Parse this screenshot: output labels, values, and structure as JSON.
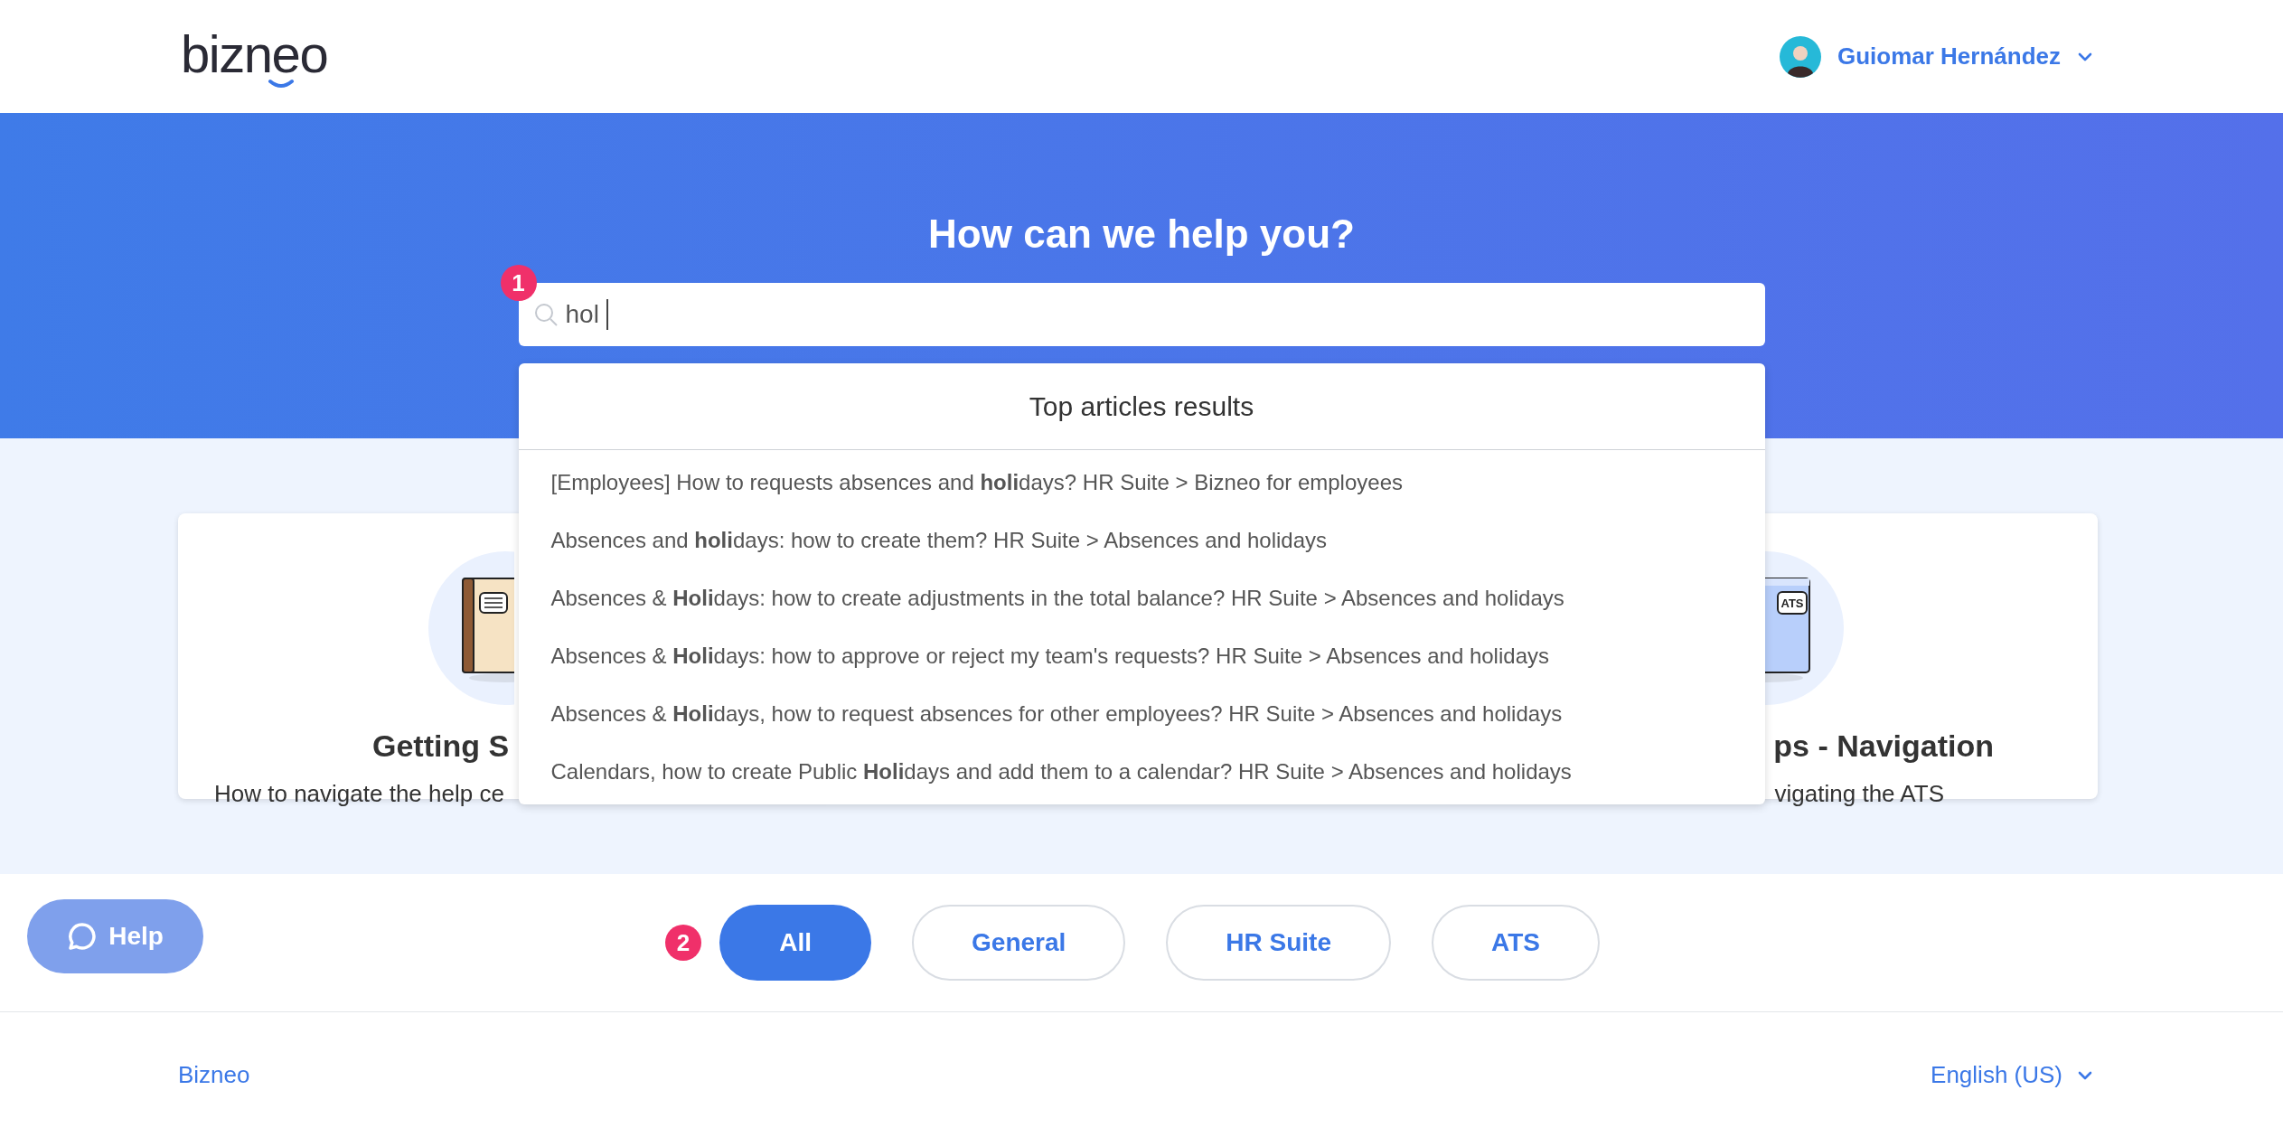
{
  "header": {
    "logo": "bizneo",
    "user": {
      "name": "Guiomar Hernández"
    }
  },
  "hero": {
    "title": "How can we help you?",
    "step_badge": "1",
    "search": {
      "value": "hol"
    }
  },
  "dropdown": {
    "title": "Top articles results",
    "results": [
      {
        "text": "[Employees] How to requests absences and **holi**days? HR Suite > Bizneo for employees"
      },
      {
        "text": "Absences and **holi**days: how to create them? HR Suite > Absences and holidays"
      },
      {
        "text": "Absences & **Holi**days: how to create adjustments in the total balance? HR Suite > Absences and holidays"
      },
      {
        "text": "Absences & **Holi**days: how to approve or reject my team's requests? HR Suite > Absences and holidays"
      },
      {
        "text": "Absences & **Holi**days, how to request absences for other employees? HR Suite > Absences and holidays"
      },
      {
        "text": "Calendars, how to create Public **Holi**days and add them to a calendar? HR Suite > Absences and holidays"
      }
    ]
  },
  "cards": [
    {
      "kind": "book",
      "title": "Getting S",
      "description": "How to navigate the help ce"
    },
    {
      "kind": "screen",
      "screen_label": "ATS",
      "title": "ps - Navigation",
      "description": "vigating the ATS"
    }
  ],
  "help_button": {
    "label": "Help"
  },
  "filters": {
    "step_badge": "2",
    "items": [
      {
        "label": "All",
        "selected": true
      },
      {
        "label": "General",
        "selected": false
      },
      {
        "label": "HR Suite",
        "selected": false
      },
      {
        "label": "ATS",
        "selected": false
      }
    ]
  },
  "footer": {
    "link": "Bizneo",
    "language": "English (US)"
  }
}
